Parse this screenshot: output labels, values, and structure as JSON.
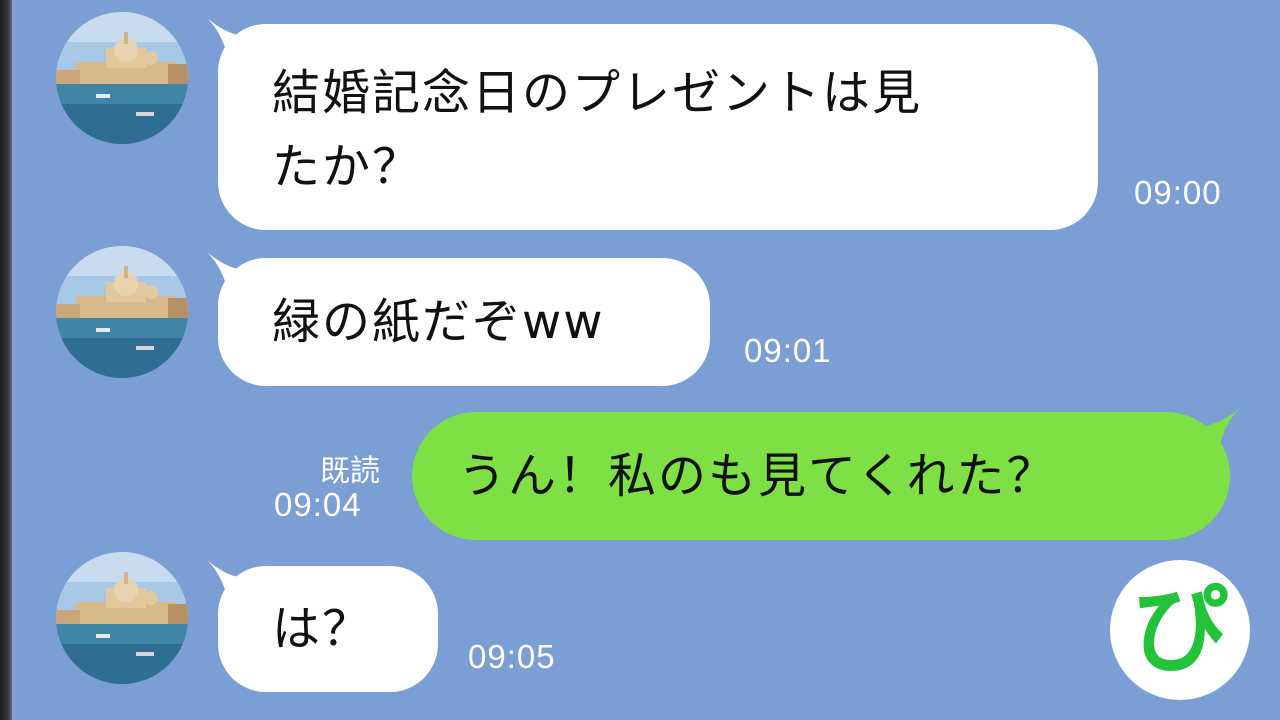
{
  "messages": [
    {
      "text_line1": "結婚記念日のプレゼントは見",
      "text_line2": "たか？",
      "time": "09:00"
    },
    {
      "text": "緑の紙だぞww",
      "time": "09:01"
    },
    {
      "text": "うん！私のも見てくれた？",
      "read_label": "既読",
      "time": "09:04"
    },
    {
      "text": "は？",
      "time": "09:05"
    }
  ],
  "logo": {
    "text": "ぴ"
  },
  "colors": {
    "background": "#7b9fd4",
    "incoming_bubble": "#ffffff",
    "outgoing_bubble": "#7ee044",
    "logo_green": "#22c33a"
  }
}
